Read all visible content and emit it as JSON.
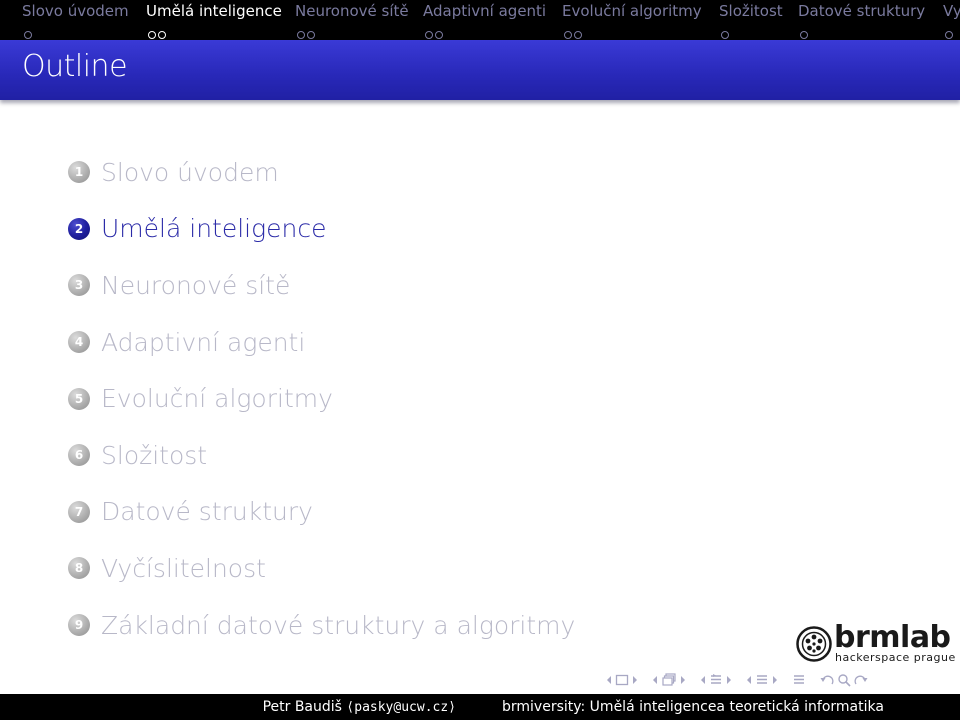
{
  "navbar": {
    "sections": [
      {
        "label": "Slovo úvodem",
        "dots": 1,
        "active": false
      },
      {
        "label": "Umělá inteligence",
        "dots": 2,
        "active": true
      },
      {
        "label": "Neuronové sítě",
        "dots": 2,
        "active": false
      },
      {
        "label": "Adaptivní agenti",
        "dots": 2,
        "active": false
      },
      {
        "label": "Evoluční algoritmy",
        "dots": 2,
        "active": false
      },
      {
        "label": "Složitost",
        "dots": 1,
        "active": false
      },
      {
        "label": "Datové struktury",
        "dots": 1,
        "active": false
      },
      {
        "label": "Vy",
        "dots": 1,
        "active": false
      }
    ]
  },
  "frame": {
    "title": "Outline"
  },
  "outline": {
    "items": [
      {
        "number": "1",
        "label": "Slovo úvodem",
        "active": false
      },
      {
        "number": "2",
        "label": "Umělá inteligence",
        "active": true
      },
      {
        "number": "3",
        "label": "Neuronové sítě",
        "active": false
      },
      {
        "number": "4",
        "label": "Adaptivní agenti",
        "active": false
      },
      {
        "number": "5",
        "label": "Evoluční algoritmy",
        "active": false
      },
      {
        "number": "6",
        "label": "Složitost",
        "active": false
      },
      {
        "number": "7",
        "label": "Datové struktury",
        "active": false
      },
      {
        "number": "8",
        "label": "Vyčíslitelnost",
        "active": false
      },
      {
        "number": "9",
        "label": "Základní datové struktury a algoritmy",
        "active": false
      }
    ]
  },
  "logo": {
    "word": "brmlab",
    "subtitle": "hackerspace prague"
  },
  "footer": {
    "author": "Petr Baudiš",
    "email": "⟨pasky@ucw.cz⟩",
    "title": "brmiversity: Umělá inteligencea teoretická informatika"
  },
  "colors": {
    "navbar_bg": "#000000",
    "title_bar": "#2828b8",
    "active_item": "#2b2ba8",
    "inactive_item": "#b8b8c8"
  }
}
